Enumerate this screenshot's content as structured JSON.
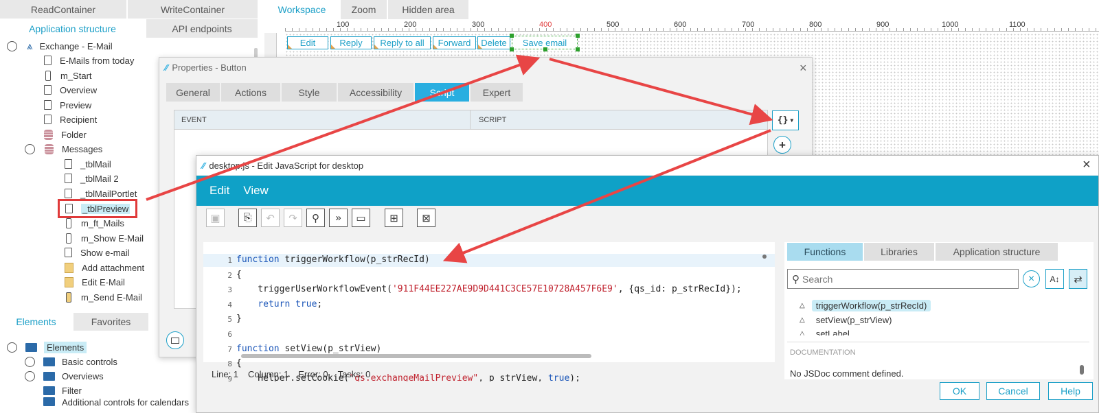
{
  "left_panel": {
    "top_tabs": [
      "ReadContainer",
      "WriteContainer"
    ],
    "sub_tabs": [
      "Application structure",
      "API endpoints"
    ],
    "root": "Exchange - E-Mail",
    "items": [
      "E-Mails from today",
      "m_Start",
      "Overview",
      "Preview",
      "Recipient",
      "Folder",
      "Messages",
      "_tblMail",
      "_tblMail 2",
      "_tblMailPortlet",
      "_tblPreview",
      "m_ft_Mails",
      "m_Show E-Mail",
      "Show e-mail",
      "Add attachment",
      "Edit E-Mail",
      "m_Send E-Mail"
    ]
  },
  "elements_panel": {
    "tabs": [
      "Elements",
      "Favorites"
    ],
    "root": "Elements",
    "items": [
      "Basic controls",
      "Overviews",
      "Filter",
      "Additional controls for calendars"
    ]
  },
  "workspace": {
    "tabs": [
      "Workspace",
      "Zoom",
      "Hidden area"
    ],
    "ruler_labels": [
      "100",
      "200",
      "300",
      "400",
      "500",
      "600",
      "700",
      "800",
      "900",
      "1000",
      "1100"
    ],
    "buttons": [
      "Edit",
      "Reply",
      "Reply to all",
      "Forward",
      "Delete",
      "Save email"
    ]
  },
  "properties_dialog": {
    "title": "Properties - Button",
    "tabs": [
      "General",
      "Actions",
      "Style",
      "Accessibility",
      "Script",
      "Expert"
    ],
    "columns": [
      "EVENT",
      "SCRIPT"
    ],
    "script_button": "{}"
  },
  "editor": {
    "title": "desktop.js - Edit JavaScript for desktop",
    "menu": [
      "Edit",
      "View"
    ],
    "code_lines": [
      {
        "num": "1",
        "parts": [
          {
            "t": "function",
            "c": "kw"
          },
          {
            "t": " triggerWorkflow(p_strRecId)",
            "c": ""
          }
        ]
      },
      {
        "num": "2",
        "parts": [
          {
            "t": "{",
            "c": ""
          }
        ]
      },
      {
        "num": "3",
        "parts": [
          {
            "t": "    triggerUserWorkflowEvent(",
            "c": ""
          },
          {
            "t": "'911F44EE227AE9D9D441C3CE57E10728A457F6E9'",
            "c": "str"
          },
          {
            "t": ", {qs_id: p_strRecId});",
            "c": ""
          }
        ]
      },
      {
        "num": "4",
        "parts": [
          {
            "t": "    ",
            "c": ""
          },
          {
            "t": "return true",
            "c": "kw"
          },
          {
            "t": ";",
            "c": ""
          }
        ]
      },
      {
        "num": "5",
        "parts": [
          {
            "t": "}",
            "c": ""
          }
        ]
      },
      {
        "num": "6",
        "parts": []
      },
      {
        "num": "7",
        "parts": [
          {
            "t": "function",
            "c": "kw"
          },
          {
            "t": " setView(p_strView)",
            "c": ""
          }
        ]
      },
      {
        "num": "8",
        "parts": [
          {
            "t": "{",
            "c": ""
          }
        ]
      },
      {
        "num": "9",
        "parts": [
          {
            "t": "    Helper.setCookie(",
            "c": ""
          },
          {
            "t": "\"qs.exchangeMailPreview\"",
            "c": "str"
          },
          {
            "t": ", p_strView, ",
            "c": ""
          },
          {
            "t": "true",
            "c": "kw"
          },
          {
            "t": ");",
            "c": ""
          }
        ]
      }
    ],
    "status": {
      "line": "Line: 1",
      "column": "Column: 1",
      "error": "Error: 0",
      "tasks": "Tasks: 0"
    },
    "right_tabs": [
      "Functions",
      "Libraries",
      "Application structure"
    ],
    "search_placeholder": "Search",
    "functions": [
      "triggerWorkflow(p_strRecId)",
      "setView(p_strView)",
      "setLabel"
    ],
    "doc_header": "DOCUMENTATION",
    "doc_text": "No JSDoc comment defined.",
    "buttons": [
      "OK",
      "Cancel",
      "Help"
    ]
  }
}
